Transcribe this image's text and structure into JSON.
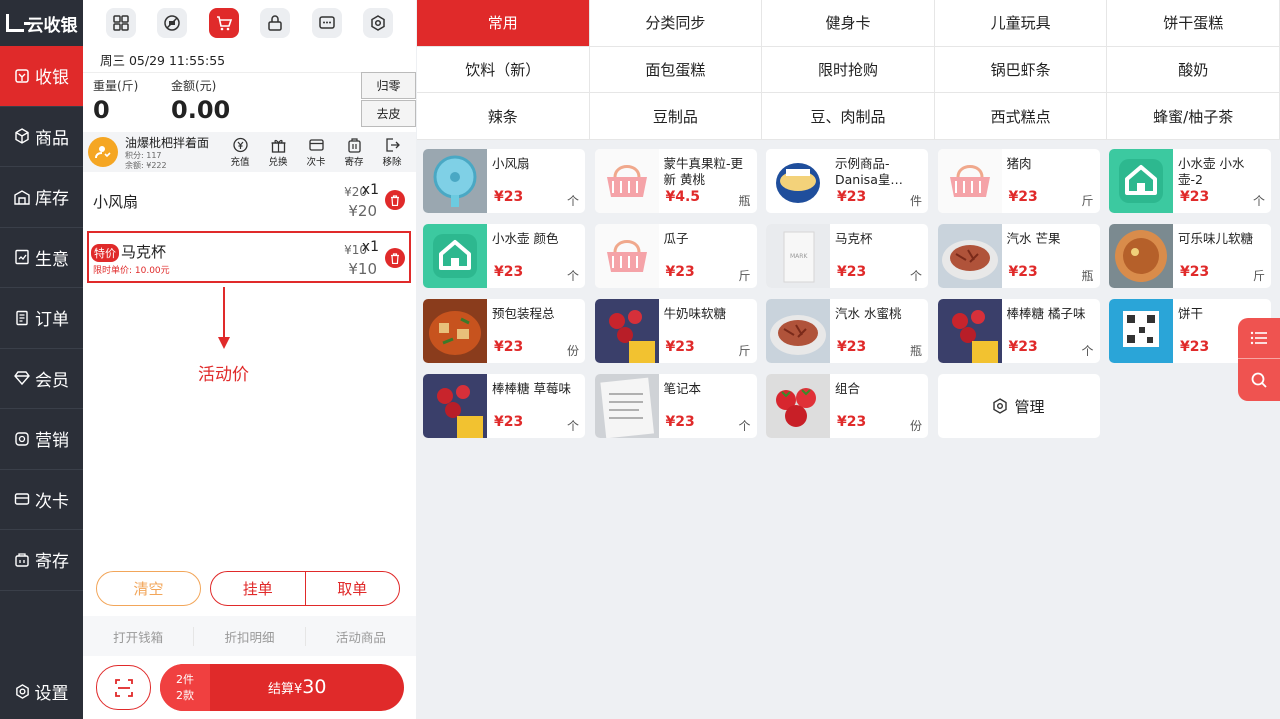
{
  "nav": {
    "logo": "云收银",
    "items": [
      {
        "label": "收银",
        "icon": "cashier-icon"
      },
      {
        "label": "商品",
        "icon": "cube-icon"
      },
      {
        "label": "库存",
        "icon": "warehouse-icon"
      },
      {
        "label": "生意",
        "icon": "report-icon"
      },
      {
        "label": "订单",
        "icon": "order-icon"
      },
      {
        "label": "会员",
        "icon": "diamond-icon"
      },
      {
        "label": "营销",
        "icon": "marketing-icon"
      },
      {
        "label": "次卡",
        "icon": "card-icon"
      },
      {
        "label": "寄存",
        "icon": "deposit-icon"
      }
    ],
    "settings": "设置",
    "active_color": "#e02a2a"
  },
  "toolbar": [
    "grid-icon",
    "scale-icon",
    "cart-icon",
    "lock-icon",
    "message-icon",
    "settings-icon"
  ],
  "datetime": "周三 05/29 11:55:55",
  "scale": {
    "weight_label": "重量(斤)",
    "weight": "0",
    "amount_label": "金额(元)",
    "amount": "0.00",
    "zero_btn": "归零",
    "tare_btn": "去皮"
  },
  "customer": {
    "name": "油爆枇杷拌着面",
    "points": "积分: 117",
    "balance": "余额: ¥222",
    "actions": [
      {
        "label": "充值",
        "icon": "recharge-icon"
      },
      {
        "label": "兑换",
        "icon": "gift-icon"
      },
      {
        "label": "次卡",
        "icon": "card-icon"
      },
      {
        "label": "寄存",
        "icon": "deposit-icon"
      },
      {
        "label": "移除",
        "icon": "exit-icon"
      }
    ]
  },
  "cart_items": [
    {
      "name": "小风扇",
      "unit_price": "¥20",
      "qty": "x1",
      "total": "¥20"
    },
    {
      "name": "马克杯",
      "tag": "特价",
      "unit_price": "¥10",
      "qty": "x1",
      "total": "¥10",
      "limit_price": "限时单价: 10.00元"
    }
  ],
  "annotation": "活动价",
  "buttons": {
    "clear": "清空",
    "hold": "挂单",
    "retrieve": "取单"
  },
  "minor": [
    "打开钱箱",
    "折扣明细",
    "活动商品"
  ],
  "pay": {
    "count_items": "2件",
    "count_kinds": "2款",
    "label": "结算",
    "currency": "¥",
    "amount": "30"
  },
  "categories": [
    "常用",
    "分类同步",
    "健身卡",
    "儿童玩具",
    "饼干蛋糕",
    "饮料（新）",
    "面包蛋糕",
    "限时抢购",
    "锅巴虾条",
    "酸奶",
    "辣条",
    "豆制品",
    "豆、肉制品",
    "西式糕点",
    "蜂蜜/柚子茶"
  ],
  "products": [
    {
      "name": "小风扇",
      "price": "¥23",
      "unit": "个",
      "thumb": "fan"
    },
    {
      "name": "蒙牛真果粒-更新 黄桃",
      "price": "¥4.5",
      "unit": "瓶",
      "thumb": "basket"
    },
    {
      "name": "示例商品-Danisa皇…",
      "price": "¥23",
      "unit": "件",
      "thumb": "cookies"
    },
    {
      "name": "猪肉",
      "price": "¥23",
      "unit": "斤",
      "thumb": "basket"
    },
    {
      "name": "小水壶 小水壶-2",
      "price": "¥23",
      "unit": "个",
      "thumb": "house"
    },
    {
      "name": "小水壶 颜色",
      "price": "¥23",
      "unit": "个",
      "thumb": "house"
    },
    {
      "name": "瓜子",
      "price": "¥23",
      "unit": "斤",
      "thumb": "basket"
    },
    {
      "name": "马克杯",
      "price": "¥23",
      "unit": "个",
      "thumb": "cup"
    },
    {
      "name": "汽水 芒果",
      "price": "¥23",
      "unit": "瓶",
      "thumb": "food"
    },
    {
      "name": "可乐味儿软糖",
      "price": "¥23",
      "unit": "斤",
      "thumb": "bowl"
    },
    {
      "name": "预包装程总",
      "price": "¥23",
      "unit": "份",
      "thumb": "stew"
    },
    {
      "name": "牛奶味软糖",
      "price": "¥23",
      "unit": "斤",
      "thumb": "candy"
    },
    {
      "name": "汽水 水蜜桃",
      "price": "¥23",
      "unit": "瓶",
      "thumb": "food"
    },
    {
      "name": "棒棒糖 橘子味",
      "price": "¥23",
      "unit": "个",
      "thumb": "candy"
    },
    {
      "name": "饼干",
      "price": "¥23",
      "unit": "",
      "thumb": "qr"
    },
    {
      "name": "棒棒糖 草莓味",
      "price": "¥23",
      "unit": "个",
      "thumb": "candy"
    },
    {
      "name": "笔记本",
      "price": "¥23",
      "unit": "个",
      "thumb": "paper"
    },
    {
      "name": "组合",
      "price": "¥23",
      "unit": "份",
      "thumb": "strawberry"
    }
  ],
  "manage": "管理"
}
